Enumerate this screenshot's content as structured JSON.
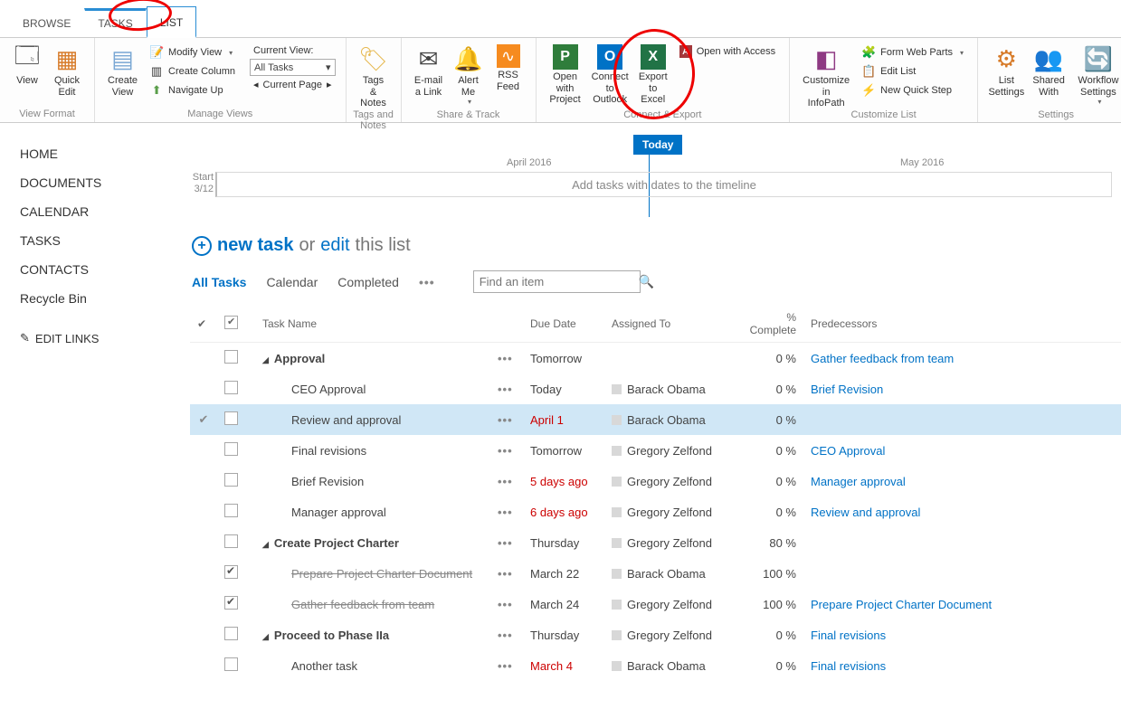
{
  "tabs": {
    "browse": "BROWSE",
    "tasks": "TASKS",
    "list": "LIST"
  },
  "ribbon": {
    "view": "View",
    "quick_edit": "Quick Edit",
    "group_view_format": "View Format",
    "create_view": "Create View",
    "modify_view": "Modify View",
    "create_column": "Create Column",
    "navigate_up": "Navigate Up",
    "current_view_label": "Current View:",
    "current_view_value": "All Tasks",
    "current_page": "Current Page",
    "group_manage_views": "Manage Views",
    "tags_notes": "Tags & Notes",
    "group_tags": "Tags and Notes",
    "email_link": "E-mail a Link",
    "alert_me": "Alert Me",
    "rss": "RSS Feed",
    "group_share": "Share & Track",
    "open_project": "Open with Project",
    "connect_outlook": "Connect to Outlook",
    "export_excel": "Export to Excel",
    "open_access": "Open with Access",
    "group_connect": "Connect & Export",
    "customize_infopath": "Customize in InfoPath",
    "form_web_parts": "Form Web Parts",
    "edit_list": "Edit List",
    "new_quick_step": "New Quick Step",
    "group_customize": "Customize List",
    "list_settings": "List Settings",
    "shared_with": "Shared With",
    "workflow_settings": "Workflow Settings",
    "group_settings": "Settings"
  },
  "leftnav": {
    "items": [
      "HOME",
      "DOCUMENTS",
      "CALENDAR",
      "TASKS",
      "CONTACTS",
      "Recycle Bin"
    ],
    "edit_links": "EDIT LINKS"
  },
  "timeline": {
    "today": "Today",
    "april": "April 2016",
    "may": "May 2016",
    "start_label": "Start",
    "start_date": "3/12",
    "placeholder": "Add tasks with dates to the timeline"
  },
  "newtask": {
    "new": "new task",
    "or": "or",
    "edit": "edit",
    "this_list": "this list"
  },
  "views": {
    "all": "All Tasks",
    "calendar": "Calendar",
    "completed": "Completed",
    "search_placeholder": "Find an item"
  },
  "columns": {
    "task": "Task Name",
    "due": "Due Date",
    "assigned": "Assigned To",
    "pct": "% Complete",
    "pred": "Predecessors"
  },
  "rows": [
    {
      "parent": true,
      "done": false,
      "name": "Approval",
      "due": "Tomorrow",
      "overdue": false,
      "assignee": "",
      "pct": "0 %",
      "pred": "Gather feedback from team"
    },
    {
      "parent": false,
      "done": false,
      "name": "CEO Approval",
      "due": "Today",
      "overdue": false,
      "assignee": "Barack Obama",
      "pct": "0 %",
      "pred": "Brief Revision"
    },
    {
      "parent": false,
      "done": false,
      "name": "Review and approval",
      "due": "April 1",
      "overdue": true,
      "assignee": "Barack Obama",
      "pct": "0 %",
      "pred": "",
      "selected": true
    },
    {
      "parent": false,
      "done": false,
      "name": "Final revisions",
      "due": "Tomorrow",
      "overdue": false,
      "assignee": "Gregory Zelfond",
      "pct": "0 %",
      "pred": "CEO Approval"
    },
    {
      "parent": false,
      "done": false,
      "name": "Brief Revision",
      "due": "5 days ago",
      "overdue": true,
      "assignee": "Gregory Zelfond",
      "pct": "0 %",
      "pred": "Manager approval"
    },
    {
      "parent": false,
      "done": false,
      "name": "Manager approval",
      "due": "6 days ago",
      "overdue": true,
      "assignee": "Gregory Zelfond",
      "pct": "0 %",
      "pred": "Review and approval"
    },
    {
      "parent": true,
      "done": false,
      "name": "Create Project Charter",
      "due": "Thursday",
      "overdue": false,
      "assignee": "Gregory Zelfond",
      "pct": "80 %",
      "pred": ""
    },
    {
      "parent": false,
      "done": true,
      "name": "Prepare Project Charter Document",
      "due": "March 22",
      "overdue": false,
      "assignee": "Barack Obama",
      "pct": "100 %",
      "pred": ""
    },
    {
      "parent": false,
      "done": true,
      "name": "Gather feedback from team",
      "due": "March 24",
      "overdue": false,
      "assignee": "Gregory Zelfond",
      "pct": "100 %",
      "pred": "Prepare Project Charter Document"
    },
    {
      "parent": true,
      "done": false,
      "name": "Proceed to Phase IIa",
      "due": "Thursday",
      "overdue": false,
      "assignee": "Gregory Zelfond",
      "pct": "0 %",
      "pred": "Final revisions"
    },
    {
      "parent": false,
      "done": false,
      "name": "Another task",
      "due": "March 4",
      "overdue": true,
      "assignee": "Barack Obama",
      "pct": "0 %",
      "pred": "Final revisions"
    }
  ]
}
